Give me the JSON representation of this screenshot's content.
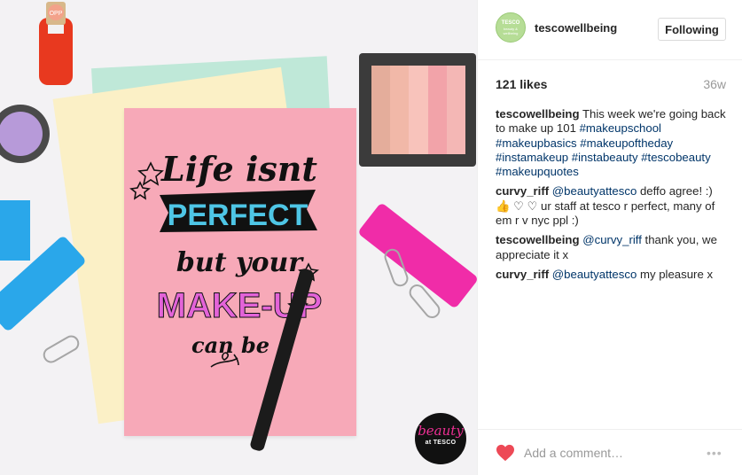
{
  "photo": {
    "card_lines": [
      "Life isnt",
      "PERFECT",
      "but your",
      "MAKE-UP",
      "can be"
    ],
    "beauty_logo_word": "beauty",
    "beauty_logo_sub": "at TESCO",
    "nail_polish_label": "OPP"
  },
  "header": {
    "avatar_top": "TESCO",
    "avatar_bottom": "beauty & wellbeing",
    "username": "tescowellbeing",
    "follow_button": "Following"
  },
  "meta": {
    "likes": "121 likes",
    "age": "36w"
  },
  "caption": {
    "user": "tescowellbeing",
    "text": "This week we're going back to make up 101",
    "hashtags": "#makeupschool #makeupbasics #makeupoftheday #instamakeup #instabeauty #tescobeauty #makeupquotes"
  },
  "comments": [
    {
      "user": "curvy_riff",
      "mention": "@beautyattesco",
      "text": "deffo agree! :) 👍 ♡ ♡ ur staff at tesco r perfect, many of em r v nyc ppl :)"
    },
    {
      "user": "tescowellbeing",
      "mention": "@curvy_riff",
      "text": "thank you, we appreciate it x"
    },
    {
      "user": "curvy_riff",
      "mention": "@beautyattesco",
      "text": "my pleasure x"
    }
  ],
  "footer": {
    "comment_placeholder": "Add a comment…",
    "more_label": "•••"
  },
  "colors": {
    "like_heart": "#ed4956",
    "hashtag_link": "#003569",
    "card_pink": "#f7a9b8",
    "banner_blue": "#4ec6e6",
    "makeup_magenta": "#e363d8"
  }
}
